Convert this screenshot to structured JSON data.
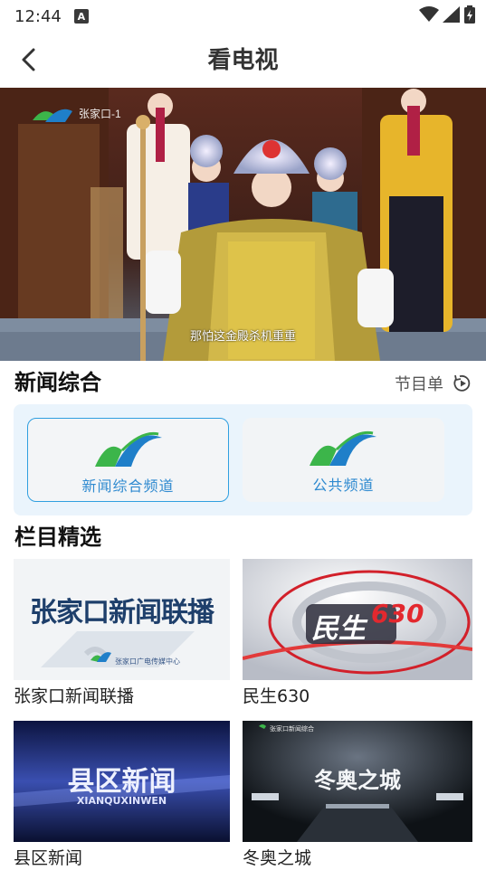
{
  "status_bar": {
    "time": "12:44",
    "badge": "A"
  },
  "header": {
    "title": "看电视"
  },
  "player": {
    "channel_watermark": "张家口-1",
    "subtitle": "那怕这金殿杀机重重"
  },
  "now_channel": {
    "title": "新闻综合",
    "schedule_label": "节目单"
  },
  "channels": [
    {
      "name": "新闻综合频道",
      "selected": true
    },
    {
      "name": "公共频道",
      "selected": false
    }
  ],
  "picks": {
    "title": "栏目精选",
    "items": [
      {
        "label": "张家口新闻联播",
        "thumb_text": "张家口新闻联播",
        "thumb_sub": "张家口广电传媒中心"
      },
      {
        "label": "民生630",
        "thumb_text": "民生",
        "thumb_num": "630"
      },
      {
        "label": "县区新闻",
        "thumb_text": "县区新闻",
        "thumb_sub": "XIANQUXINWEN"
      },
      {
        "label": "冬奥之城",
        "thumb_text": "冬奥之城",
        "thumb_sub": "张家口新闻综合"
      }
    ]
  },
  "colors": {
    "accent": "#2f9fe0",
    "panel_bg": "#eaf4fc",
    "logo_green": "#3cb54a",
    "logo_blue": "#1f7fc9"
  }
}
